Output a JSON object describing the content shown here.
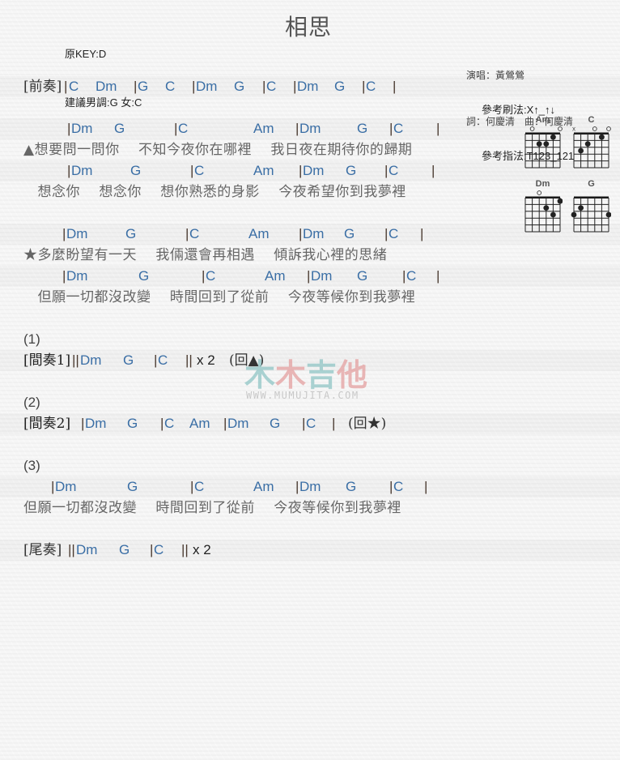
{
  "header": {
    "original_key": "原KEY:D",
    "suggested_key": "建議男調:G 女:C",
    "title": "相思",
    "singer": "演唱：黃鶯鶯",
    "credits": "詞：何慶清　曲：何慶清",
    "strum_pattern": "參考刷法:X↑_↑↓",
    "finger_pattern": "參考指法:T123_121"
  },
  "chord_diagrams": [
    {
      "name": "Am",
      "top": [
        "",
        "o",
        "",
        "",
        "",
        "o"
      ],
      "dots": [
        [
          2,
          4
        ],
        [
          2,
          3
        ],
        [
          1,
          2
        ]
      ]
    },
    {
      "name": "C",
      "top": [
        "x",
        "",
        "",
        "o",
        "",
        "o"
      ],
      "dots": [
        [
          3,
          5
        ],
        [
          2,
          4
        ],
        [
          1,
          2
        ]
      ]
    },
    {
      "name": "Dm",
      "top": [
        "",
        "",
        "o",
        "",
        "",
        ""
      ],
      "dots": [
        [
          2,
          3
        ],
        [
          3,
          2
        ],
        [
          1,
          1
        ]
      ]
    },
    {
      "name": "G",
      "top": [
        "",
        "",
        "",
        "",
        "",
        ""
      ],
      "dots": [
        [
          3,
          6
        ],
        [
          2,
          5
        ],
        [
          3,
          1
        ]
      ]
    }
  ],
  "intro": {
    "label": "[前奏]",
    "chords": [
      "C",
      "Dm",
      "G",
      "C",
      "Dm",
      "G",
      "C",
      "Dm",
      "G",
      "C"
    ]
  },
  "verse_a": {
    "chords1": [
      "Dm",
      "G",
      "C",
      "Am",
      "Dm",
      "G",
      "C"
    ],
    "lyric1": "▲想要問一問你　 不知今夜你在哪裡　 我日夜在期待你的歸期",
    "chords2": [
      "Dm",
      "G",
      "C",
      "Am",
      "Dm",
      "G",
      "C"
    ],
    "lyric2": "　想念你　 想念你　 想你熟悉的身影　 今夜希望你到我夢裡"
  },
  "verse_b": {
    "chords1": [
      "Dm",
      "G",
      "C",
      "Am",
      "Dm",
      "G",
      "C"
    ],
    "lyric1": "★多麼盼望有一天　 我倆還會再相遇　 傾訴我心裡的思緒",
    "chords2": [
      "Dm",
      "G",
      "C",
      "Am",
      "Dm",
      "G",
      "C"
    ],
    "lyric2": "　但願一切都沒改變　 時間回到了從前　 今夜等候你到我夢裡"
  },
  "section1": {
    "marker": "(1)",
    "label": "[間奏1]",
    "chords": [
      "Dm",
      "G",
      "C"
    ],
    "repeat": "x 2",
    "back": "(回▲)"
  },
  "section2": {
    "marker": "(2)",
    "label": "[間奏2]",
    "chords": [
      "Dm",
      "G",
      "C",
      "Am",
      "Dm",
      "G",
      "C"
    ],
    "back": "(回★)"
  },
  "section3": {
    "marker": "(3)",
    "chords": [
      "Dm",
      "G",
      "C",
      "Am",
      "Dm",
      "G",
      "C"
    ],
    "lyric": "但願一切都沒改變　 時間回到了從前　 今夜等候你到我夢裡"
  },
  "outro": {
    "label": "[尾奏]",
    "chords": [
      "Dm",
      "G",
      "C"
    ],
    "repeat": "x 2"
  },
  "watermark": {
    "text": "木木吉他",
    "url_text": "WWW.MUMUJITA.COM"
  }
}
